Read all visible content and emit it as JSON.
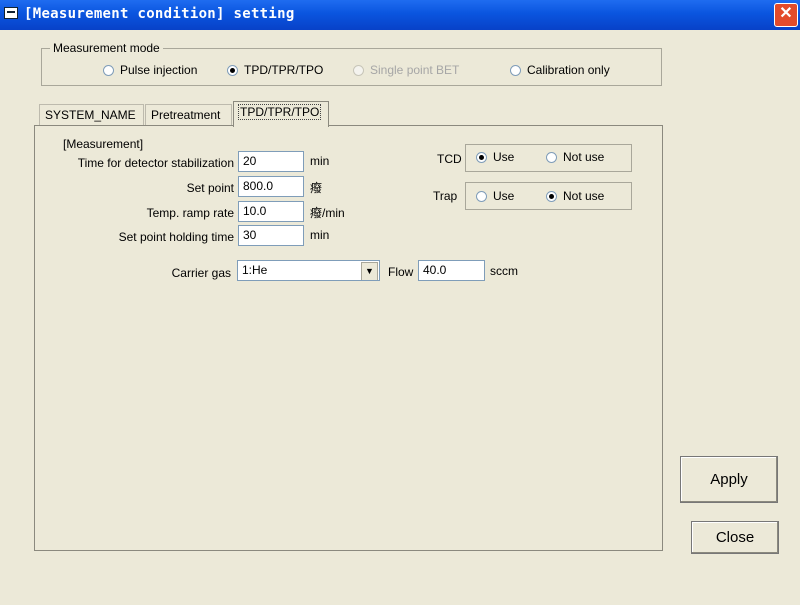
{
  "window": {
    "title": "[Measurement condition] setting",
    "close_glyph": "✕"
  },
  "measurement_mode": {
    "legend": "Measurement mode",
    "options": [
      {
        "label": "Pulse injection",
        "checked": false,
        "disabled": false
      },
      {
        "label": "TPD/TPR/TPO",
        "checked": true,
        "disabled": false
      },
      {
        "label": "Single point BET",
        "checked": false,
        "disabled": true
      },
      {
        "label": "Calibration only",
        "checked": false,
        "disabled": false
      }
    ]
  },
  "tabs": [
    {
      "label": "SYSTEM_NAME",
      "active": false
    },
    {
      "label": "Pretreatment",
      "active": false
    },
    {
      "label": "TPD/TPR/TPO",
      "active": true
    }
  ],
  "measurement": {
    "section_label": "[Measurement]",
    "fields": [
      {
        "label": "Time for detector stabilization",
        "value": "20",
        "unit": "min"
      },
      {
        "label": "Set point",
        "value": "800.0",
        "unit": "癈"
      },
      {
        "label": "Temp. ramp rate",
        "value": "10.0",
        "unit": "癈/min"
      },
      {
        "label": "Set point holding time",
        "value": "30",
        "unit": "min"
      }
    ],
    "carrier_gas": {
      "label": "Carrier gas",
      "value": "1:He"
    },
    "flow": {
      "label": "Flow",
      "value": "40.0",
      "unit": "sccm"
    }
  },
  "tcd": {
    "label": "TCD",
    "options": [
      {
        "label": "Use",
        "checked": true
      },
      {
        "label": "Not use",
        "checked": false
      }
    ]
  },
  "trap": {
    "label": "Trap",
    "options": [
      {
        "label": "Use",
        "checked": false
      },
      {
        "label": "Not use",
        "checked": true
      }
    ]
  },
  "buttons": {
    "apply": "Apply",
    "close": "Close"
  }
}
